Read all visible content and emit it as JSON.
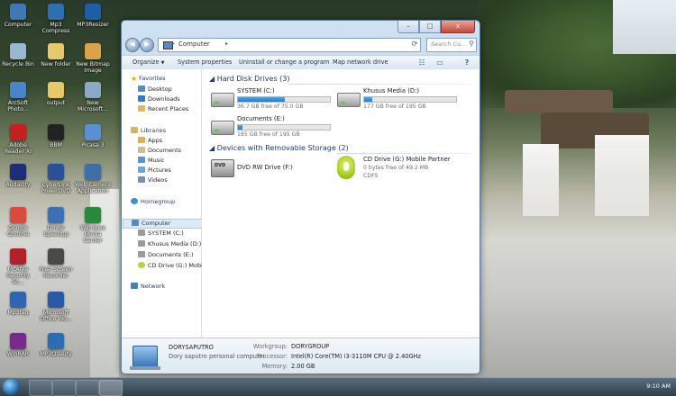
{
  "desktop": {
    "icons": [
      {
        "label": "Computer",
        "color": "#3f78b5"
      },
      {
        "label": "Mp3 Compress",
        "color": "#2f6fb0"
      },
      {
        "label": "MP3Resizer",
        "color": "#1c5ea7"
      },
      {
        "label": "Recycle Bin",
        "color": "#9ab7d1"
      },
      {
        "label": "New folder",
        "color": "#e7c86a"
      },
      {
        "label": "New Bitmap Image",
        "color": "#d9a34a"
      },
      {
        "label": "ArcSoft Photo...",
        "color": "#4a85c9"
      },
      {
        "label": "output",
        "color": "#e7c86a"
      },
      {
        "label": "New Microsoft...",
        "color": "#8aa9c4"
      },
      {
        "label": "Adobe Reader XI",
        "color": "#c51f1f"
      },
      {
        "label": "BBM",
        "color": "#222222"
      },
      {
        "label": "Picasa 3",
        "color": "#5c8ed6"
      },
      {
        "label": "Audacity",
        "color": "#1d2d7a"
      },
      {
        "label": "CyberLink PowerDVD",
        "color": "#2a4f9b"
      },
      {
        "label": "Web Camera Application",
        "color": "#3d6fa8"
      },
      {
        "label": "Google Chrome",
        "color": "#d94b3b"
      },
      {
        "label": "Driver Speedup",
        "color": "#3c6fb6"
      },
      {
        "label": "Windows Media Center",
        "color": "#2a8a3b"
      },
      {
        "label": "McAfee Security Sc...",
        "color": "#b3202a"
      },
      {
        "label": "Free Screen Recorder",
        "color": "#4a4a4a"
      },
      {
        "label": "Mp3tag",
        "color": "#2e66b0"
      },
      {
        "label": "Microsoft Office Wo...",
        "color": "#2b5aa5"
      },
      {
        "label": "WinRAR",
        "color": "#7a2a8c"
      },
      {
        "label": "MP3Quality",
        "color": "#2d6bb3"
      }
    ]
  },
  "taskbar": {
    "time": "9:10 AM"
  },
  "window": {
    "caption_buttons": {
      "minimize": "–",
      "maximize": "□",
      "close": "x"
    },
    "address": {
      "path": "Computer",
      "sep1": "▸",
      "sep2": "▸"
    },
    "search_placeholder": "Search Co...",
    "toolbar": {
      "organize": "Organize",
      "system_properties": "System properties",
      "uninstall": "Uninstall or change a program",
      "map_drive": "Map network drive"
    },
    "sidebar": {
      "favorites": "Favorites",
      "desktop": "Desktop",
      "downloads": "Downloads",
      "recent_places": "Recent Places",
      "libraries": "Libraries",
      "apps": "Apps",
      "documents": "Documents",
      "music": "Music",
      "pictures": "Pictures",
      "videos": "Videos",
      "homegroup": "Homegroup",
      "computer": "Computer",
      "system_c": "SYSTEM (C:)",
      "khusus_d": "Khusus Media (D:)",
      "documents_e": "Documents (E:)",
      "cd_drive_g": "CD Drive (G:) Mobile",
      "network": "Network"
    },
    "content": {
      "hdd_header": "Hard Disk Drives (3)",
      "removable_header": "Devices with Removable Storage (2)",
      "drives": [
        {
          "name": "SYSTEM (C:)",
          "free": "36.7 GB free of 75.0 GB",
          "used_fraction": 0.51
        },
        {
          "name": "Khusus Media (D:)",
          "free": "177 GB free of 195 GB",
          "used_fraction": 0.09
        },
        {
          "name": "Documents (E:)",
          "free": "185 GB free of 195 GB",
          "used_fraction": 0.05
        }
      ],
      "removable": [
        {
          "name": "DVD RW Drive (F:)",
          "icon_text": "DVD"
        },
        {
          "name": "CD Drive (G:) Mobile Partner",
          "free": "0 bytes free of 49.2 MB",
          "fs": "CDFS"
        }
      ]
    },
    "details": {
      "name": "DORYSAPUTRO",
      "description": "Dory saputro personal computer",
      "workgroup_label": "Workgroup:",
      "workgroup": "DORYGROUP",
      "processor_label": "Processor:",
      "processor": "Intel(R) Core(TM) i3-3110M CPU @ 2.40GHz",
      "memory_label": "Memory:",
      "memory": "2.00 GB"
    }
  }
}
